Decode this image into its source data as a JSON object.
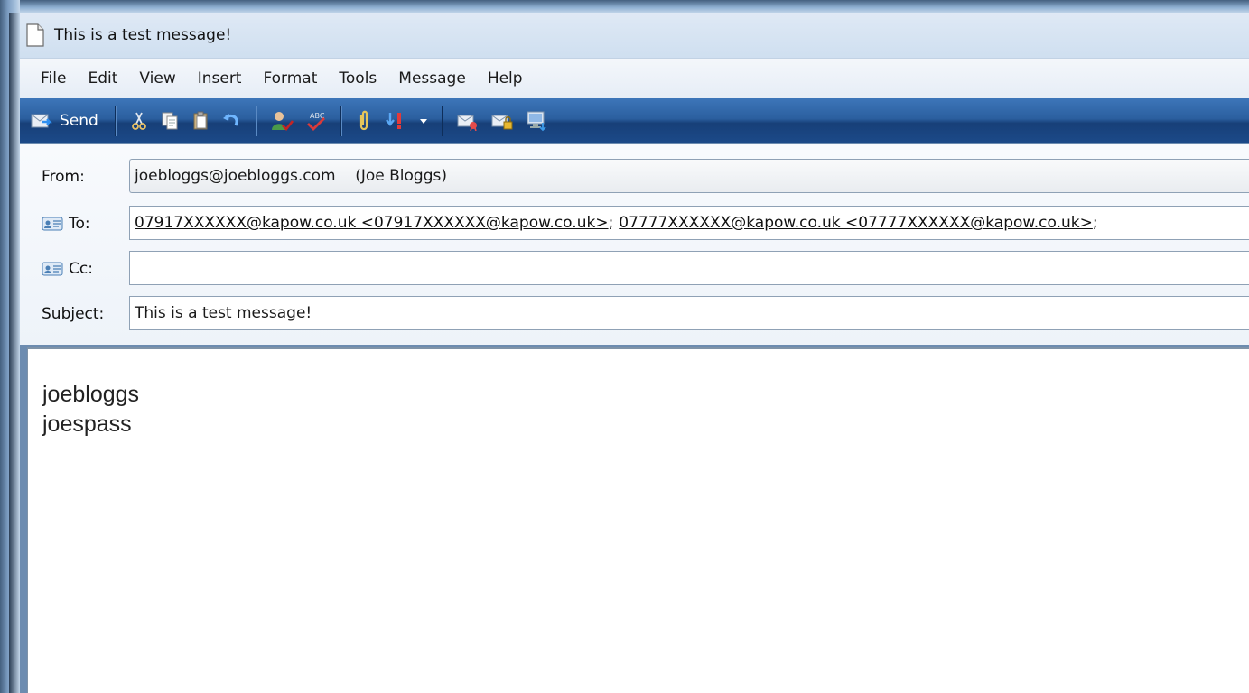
{
  "window": {
    "title": "This is a test message!"
  },
  "menu": [
    "File",
    "Edit",
    "View",
    "Insert",
    "Format",
    "Tools",
    "Message",
    "Help"
  ],
  "toolbar": {
    "send_label": "Send",
    "icons": [
      "send-icon",
      "cut-icon",
      "copy-icon",
      "paste-icon",
      "undo-icon",
      "check-names-icon",
      "spelling-icon",
      "attach-icon",
      "priority-icon",
      "priority-dropdown-icon",
      "sign-icon",
      "encrypt-icon",
      "work-offline-icon"
    ]
  },
  "headers": {
    "from_label": "From:",
    "from_value": "joebloggs@joebloggs.com    (Joe Bloggs)",
    "to_label": "To:",
    "to_recipients": [
      "07917XXXXXX@kapow.co.uk <07917XXXXXX@kapow.co.uk>",
      "07777XXXXXX@kapow.co.uk <07777XXXXXX@kapow.co.uk>"
    ],
    "to_separator": ";",
    "cc_label": "Cc:",
    "cc_value": "",
    "subject_label": "Subject:",
    "subject_value": "This is a test message!"
  },
  "body": {
    "lines": [
      "joebloggs",
      "joespass"
    ]
  },
  "colors": {
    "toolbar_top": "#3d76b9",
    "toolbar_bottom": "#173f78",
    "titlebar": "#dfe9f5"
  }
}
